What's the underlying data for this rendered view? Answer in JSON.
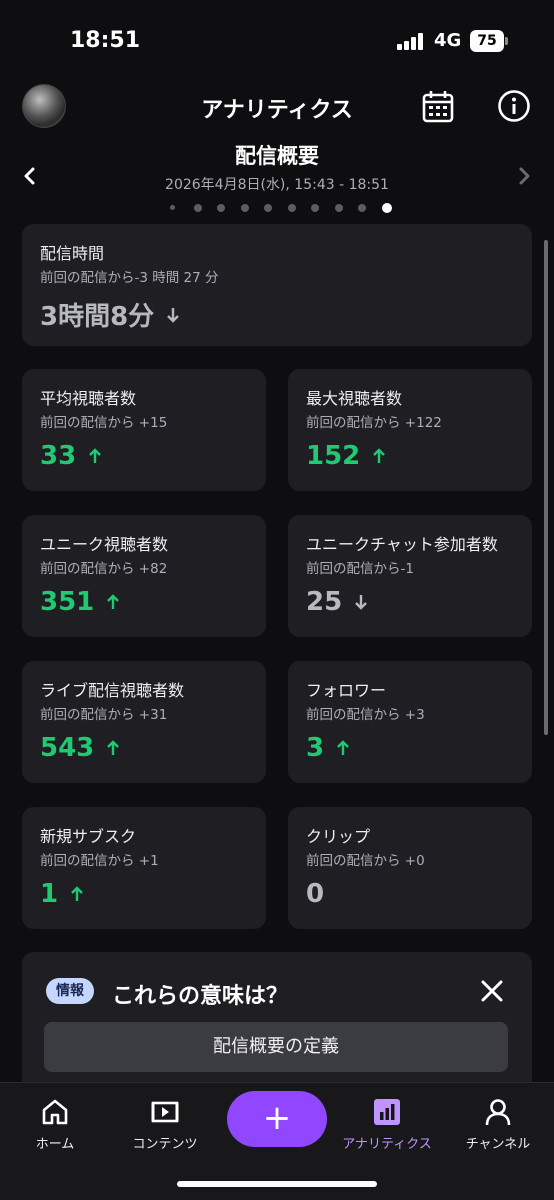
{
  "status_bar": {
    "time": "18:51",
    "network": "4G",
    "battery": "75"
  },
  "header": {
    "title": "アナリティクス",
    "avatar_icon": "avatar",
    "calendar_icon": "calendar-icon",
    "info_icon": "info-icon"
  },
  "section": {
    "title": "配信概要",
    "date": "2026年4月8日(水), 15:43 - 18:51",
    "page_count": 10,
    "active_page": 10
  },
  "duration_card": {
    "title": "配信時間",
    "sub": "前回の配信から-3 時間 27 分",
    "value": "3時間8分",
    "trend": "down"
  },
  "stats": [
    {
      "title": "平均視聴者数",
      "sub": "前回の配信から +15",
      "value": "33",
      "trend": "up"
    },
    {
      "title": "最大視聴者数",
      "sub": "前回の配信から +122",
      "value": "152",
      "trend": "up"
    },
    {
      "title": "ユニーク視聴者数",
      "sub": "前回の配信から +82",
      "value": "351",
      "trend": "up"
    },
    {
      "title": "ユニークチャット参加者数",
      "sub": "前回の配信から-1",
      "value": "25",
      "trend": "down"
    },
    {
      "title": "ライブ配信視聴者数",
      "sub": "前回の配信から +31",
      "value": "543",
      "trend": "up"
    },
    {
      "title": "フォロワー",
      "sub": "前回の配信から +3",
      "value": "3",
      "trend": "up"
    },
    {
      "title": "新規サブスク",
      "sub": "前回の配信から +1",
      "value": "1",
      "trend": "up"
    },
    {
      "title": "クリップ",
      "sub": "前回の配信から +0",
      "value": "0",
      "trend": "neutral"
    }
  ],
  "info_panel": {
    "badge": "情報",
    "heading": "これらの意味は？",
    "button": "配信概要の定義"
  },
  "bottom_nav": {
    "items": [
      {
        "label": "ホーム",
        "icon": "home-icon"
      },
      {
        "label": "コンテンツ",
        "icon": "content-icon"
      },
      {
        "label": "+",
        "icon": "plus-icon"
      },
      {
        "label": "アナリティクス",
        "icon": "analytics-icon",
        "active": true
      },
      {
        "label": "チャンネル",
        "icon": "profile-icon"
      }
    ]
  },
  "colors": {
    "up": "#1fca73",
    "accent": "#9147ff",
    "active_tab": "#bf94ff",
    "info_badge": "#c5d6ff"
  }
}
